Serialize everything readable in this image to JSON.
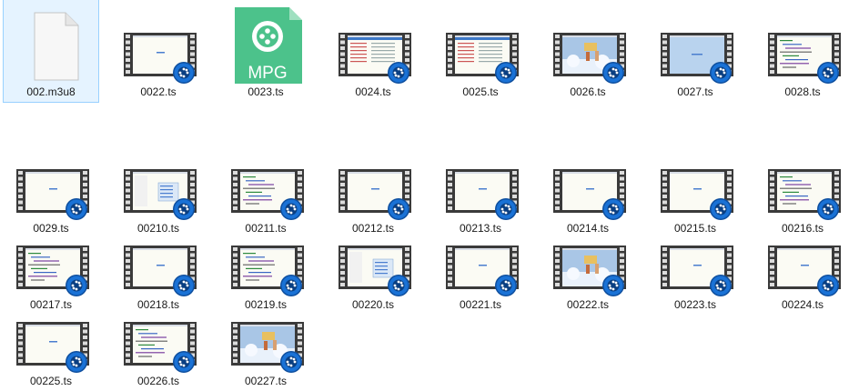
{
  "window": {
    "view": "Large icons",
    "background": "#ffffff"
  },
  "icon_kinds": {
    "generic": "blank-file-icon",
    "mpg": "mpg-file-icon",
    "video": "video-filmstrip-icon"
  },
  "mpg_icon_text": "MPG",
  "colors": {
    "film": "#3a3a3a",
    "player_badge": "#1a72d6",
    "mpg_green": "#4cc28b",
    "selection": "#e5f3ff"
  },
  "files": [
    {
      "name": "002.m3u8",
      "kind": "generic",
      "selected": true
    },
    {
      "name": "0022.ts",
      "kind": "video",
      "preview": "white"
    },
    {
      "name": "0023.ts",
      "kind": "mpg"
    },
    {
      "name": "0024.ts",
      "kind": "video",
      "preview": "table"
    },
    {
      "name": "0025.ts",
      "kind": "video",
      "preview": "table"
    },
    {
      "name": "0026.ts",
      "kind": "video",
      "preview": "sky"
    },
    {
      "name": "0027.ts",
      "kind": "video",
      "preview": "blue"
    },
    {
      "name": "0028.ts",
      "kind": "video",
      "preview": "code"
    },
    {
      "name": "0029.ts",
      "kind": "video",
      "preview": "white"
    },
    {
      "name": "00210.ts",
      "kind": "video",
      "preview": "menu"
    },
    {
      "name": "00211.ts",
      "kind": "video",
      "preview": "code"
    },
    {
      "name": "00212.ts",
      "kind": "video",
      "preview": "white"
    },
    {
      "name": "00213.ts",
      "kind": "video",
      "preview": "white"
    },
    {
      "name": "00214.ts",
      "kind": "video",
      "preview": "white"
    },
    {
      "name": "00215.ts",
      "kind": "video",
      "preview": "white"
    },
    {
      "name": "00216.ts",
      "kind": "video",
      "preview": "code"
    },
    {
      "name": "00217.ts",
      "kind": "video",
      "preview": "code"
    },
    {
      "name": "00218.ts",
      "kind": "video",
      "preview": "white"
    },
    {
      "name": "00219.ts",
      "kind": "video",
      "preview": "code"
    },
    {
      "name": "00220.ts",
      "kind": "video",
      "preview": "menu"
    },
    {
      "name": "00221.ts",
      "kind": "video",
      "preview": "white"
    },
    {
      "name": "00222.ts",
      "kind": "video",
      "preview": "sky"
    },
    {
      "name": "00223.ts",
      "kind": "video",
      "preview": "white"
    },
    {
      "name": "00224.ts",
      "kind": "video",
      "preview": "white"
    },
    {
      "name": "00225.ts",
      "kind": "video",
      "preview": "white"
    },
    {
      "name": "00226.ts",
      "kind": "video",
      "preview": "code"
    },
    {
      "name": "00227.ts",
      "kind": "video",
      "preview": "sky"
    }
  ]
}
